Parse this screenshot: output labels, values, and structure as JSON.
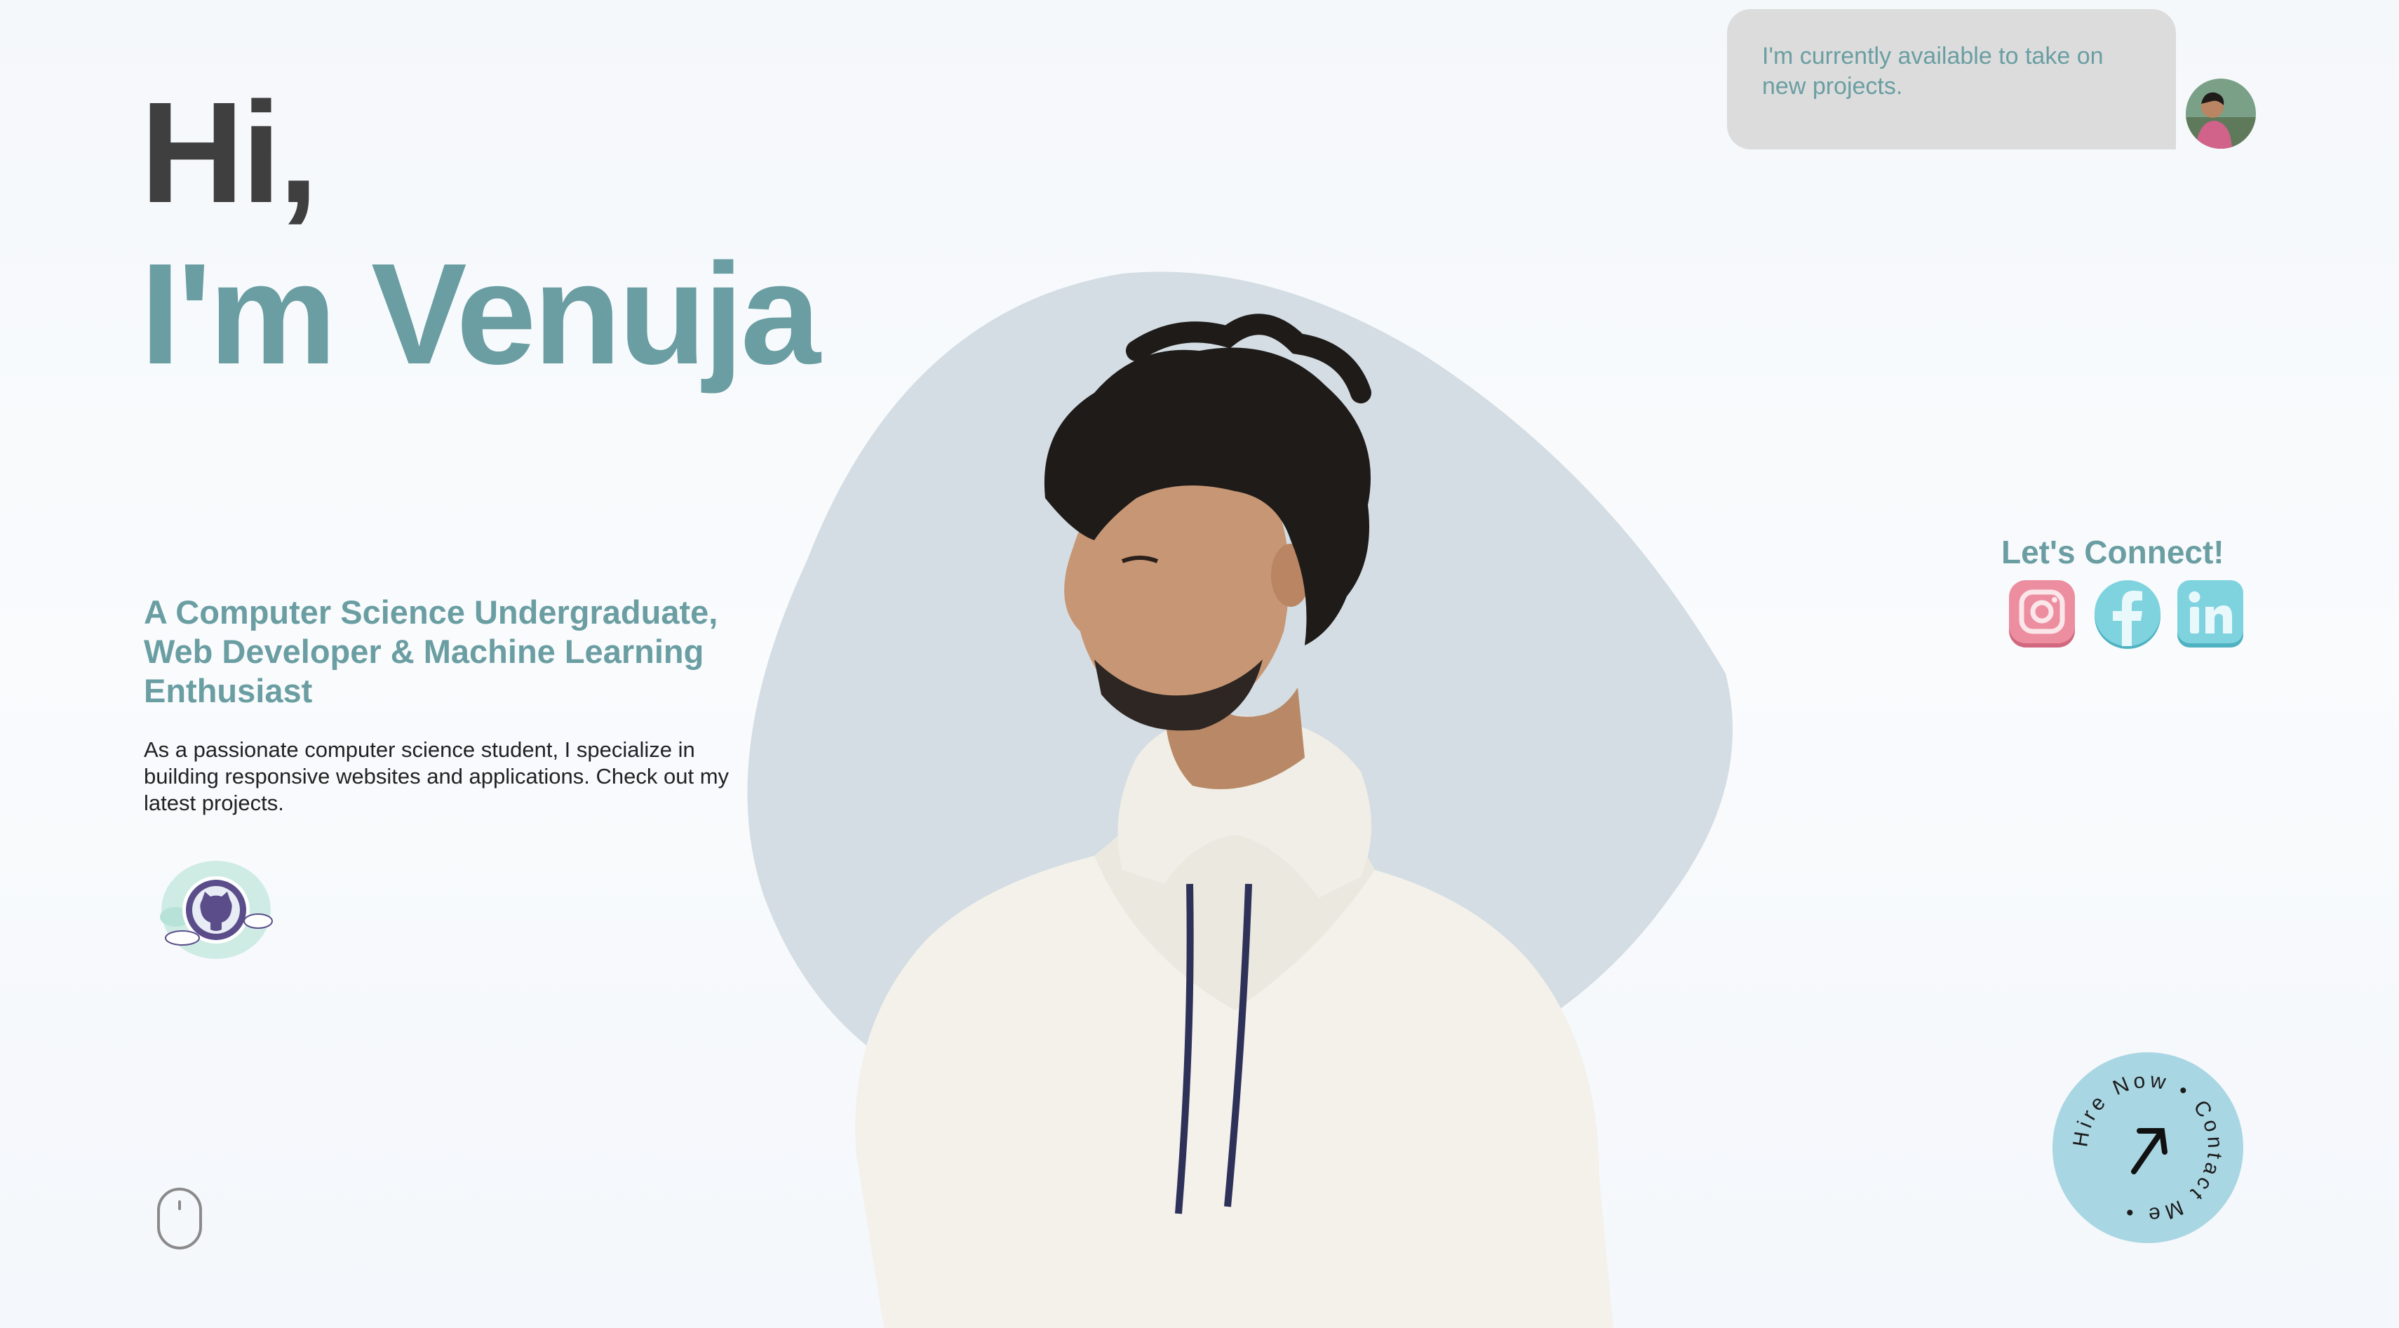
{
  "hero": {
    "greeting": "Hi,",
    "name": "I'm Venuja",
    "tagline": "A Computer Science Undergraduate, Web Developer & Machine Learning Enthusiast",
    "intro": "As a passionate computer science student, I specialize in building responsive websites and applications. Check out my latest projects."
  },
  "availability": {
    "message": "I'm currently available to take on new projects."
  },
  "connect": {
    "title": "Let's Connect!",
    "socials": [
      {
        "name": "instagram-icon",
        "color": "#e8798f"
      },
      {
        "name": "facebook-icon",
        "color": "#67c5d3"
      },
      {
        "name": "linkedin-icon",
        "color": "#67c5d3"
      }
    ]
  },
  "hire_badge": {
    "ring_text": "Hire Now • Contact Me •",
    "color": "#a9d6e3"
  },
  "colors": {
    "accent": "#6a9ea2",
    "heading_dark": "#3f3f3f",
    "blob": "#d3dde3",
    "bubble": "#dcdcdc"
  },
  "icons": {
    "github": "github-octocat-icon",
    "scroll": "mouse-scroll-icon",
    "arrow": "arrow-up-right-icon"
  }
}
